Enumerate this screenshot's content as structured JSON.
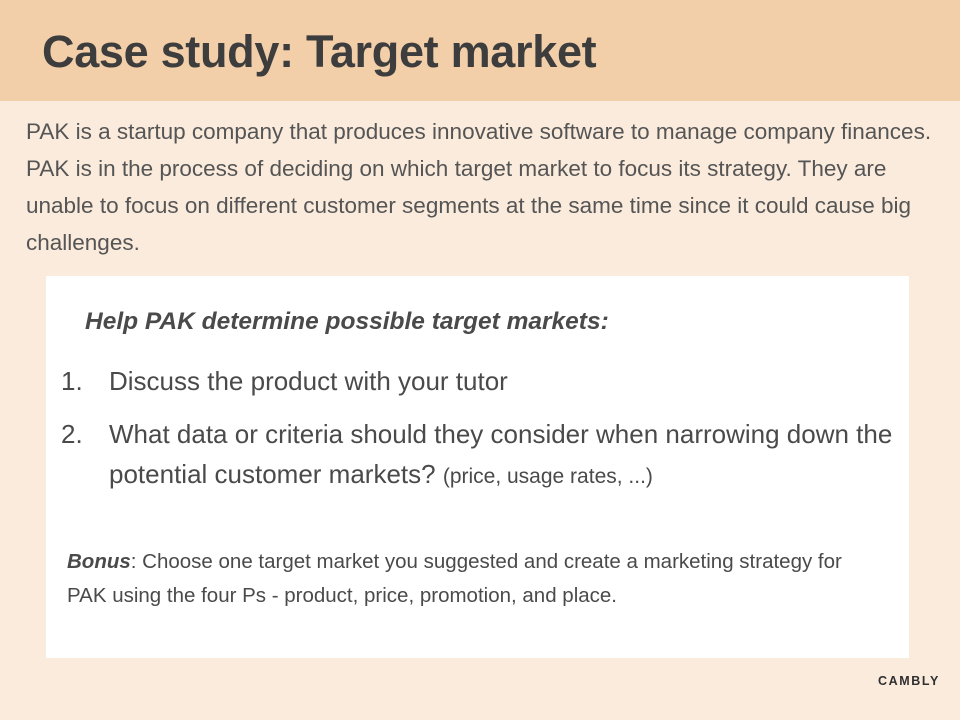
{
  "slide": {
    "title": "Case study: Target market",
    "intro": "PAK is a startup company that produces innovative software to manage company finances. PAK is in the process of deciding on which target market to focus its strategy. They are unable to focus on different customer segments at the same time since it could cause big challenges.",
    "card": {
      "heading": "Help PAK determine possible target markets:",
      "tasks": [
        {
          "number": "1.",
          "text": "Discuss the product with your tutor",
          "hint": ""
        },
        {
          "number": "2.",
          "text": "What data or criteria should they consider when narrowing down the potential customer markets?",
          "hint": "(price, usage rates, ...)"
        }
      ],
      "bonus_label": "Bonus",
      "bonus_text": ": Choose one target market you suggested and create a marketing strategy for PAK using the four Ps - product, price, promotion, and place."
    },
    "logo": "CAMBLY"
  },
  "colors": {
    "background": "#faebdc",
    "header": "#f2cfa9",
    "card": "#ffffff",
    "text": "#4a4a4a"
  }
}
